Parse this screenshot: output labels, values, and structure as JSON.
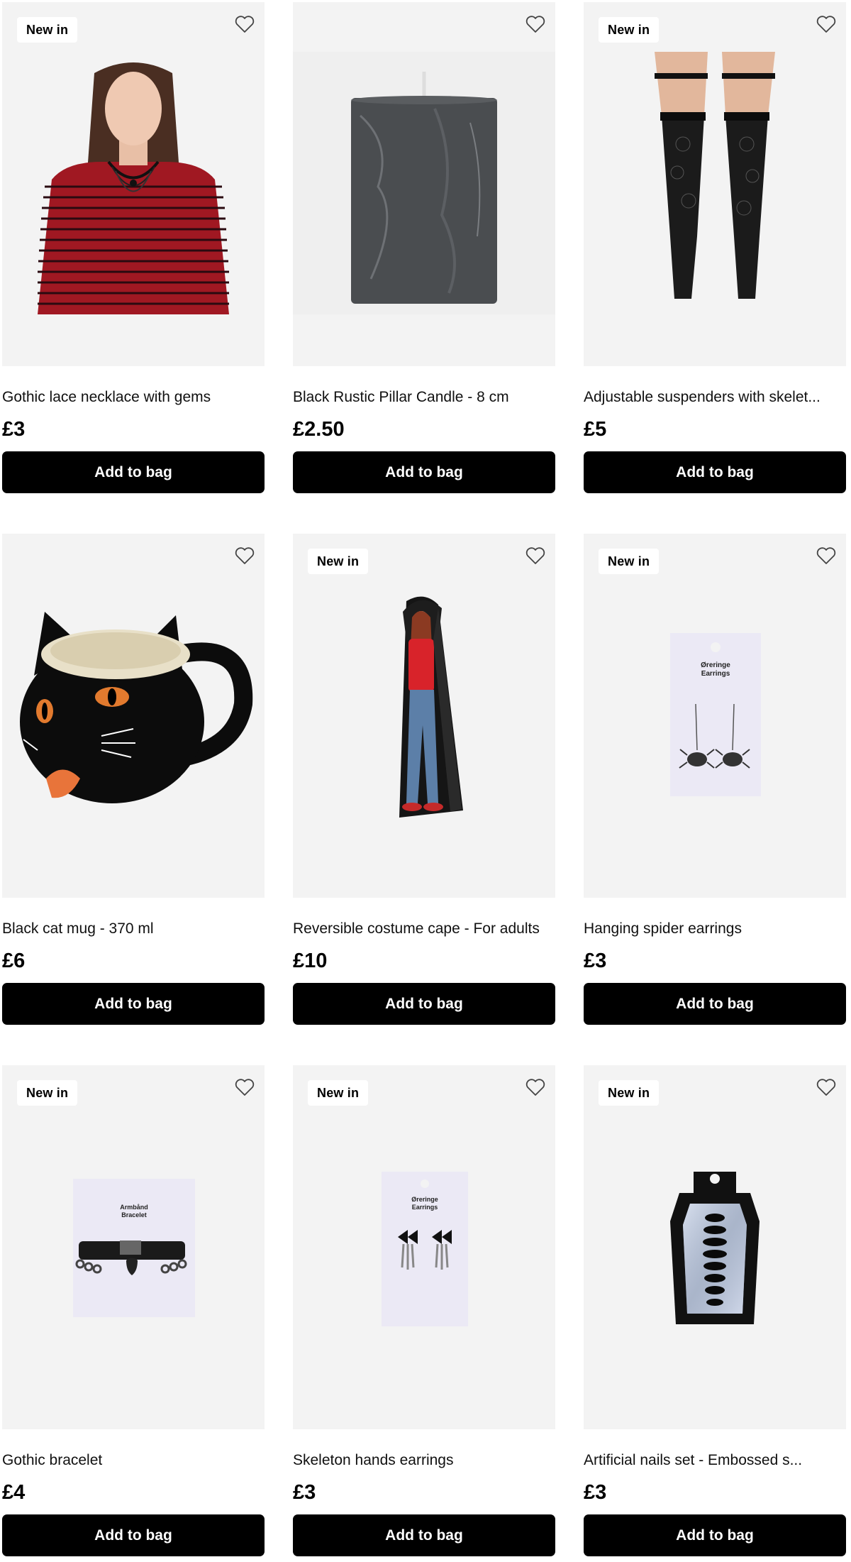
{
  "products": [
    {
      "badge": "New in",
      "title": "Gothic lace necklace with gems",
      "price": "£3",
      "button": "Add to bag"
    },
    {
      "badge": "",
      "title": "Black Rustic Pillar Candle - 8 cm",
      "price": "£2.50",
      "button": "Add to bag"
    },
    {
      "badge": "New in",
      "title": "Adjustable suspenders with skelet...",
      "price": "£5",
      "button": "Add to bag"
    },
    {
      "badge": "",
      "title": "Black cat mug - 370 ml",
      "price": "£6",
      "button": "Add to bag"
    },
    {
      "badge": "New in",
      "title": "Reversible costume cape - For adults",
      "price": "£10",
      "button": "Add to bag"
    },
    {
      "badge": "New in",
      "title": "Hanging spider earrings",
      "price": "£3",
      "button": "Add to bag"
    },
    {
      "badge": "New in",
      "title": "Gothic bracelet",
      "price": "£4",
      "button": "Add to bag"
    },
    {
      "badge": "New in",
      "title": "Skeleton hands earrings",
      "price": "£3",
      "button": "Add to bag"
    },
    {
      "badge": "New in",
      "title": "Artificial nails set - Embossed s...",
      "price": "£3",
      "button": "Add to bag"
    }
  ],
  "packaging_text": {
    "spider_earrings": {
      "line1": "Øreringe",
      "line2": "Earrings"
    },
    "bracelet": {
      "line1": "Armbånd",
      "line2": "Bracelet"
    },
    "skeleton_earrings": {
      "line1": "Øreringe",
      "line2": "Earrings"
    }
  },
  "icons": {
    "wishlist": "heart-outline-icon"
  },
  "colors": {
    "button_bg": "#000000",
    "button_text": "#ffffff",
    "image_bg": "#f3f3f3",
    "badge_bg": "#ffffff"
  }
}
